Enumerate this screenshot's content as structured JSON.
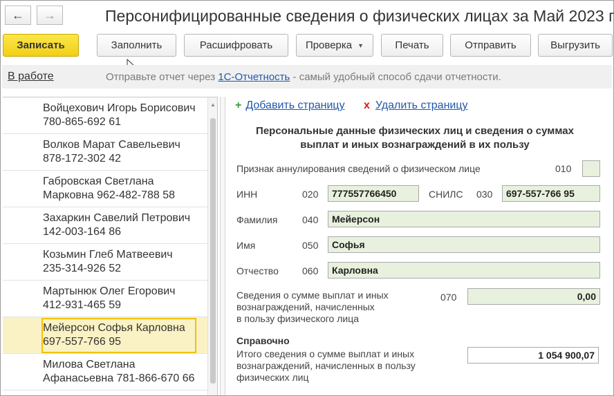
{
  "window": {
    "title": "Персонифицированные сведения о физических лицах за Май 2023 г"
  },
  "toolbar": {
    "write": "Записать",
    "fill": "Заполнить",
    "decode": "Расшифровать",
    "check": "Проверка",
    "print": "Печать",
    "send": "Отправить",
    "export": "Выгрузить"
  },
  "status": {
    "state": "В работе",
    "hint_prefix": "Отправьте отчет через ",
    "hint_link": "1С-Отчетность",
    "hint_suffix": " - самый удобный способ сдачи отчетности."
  },
  "list": {
    "items": [
      {
        "line1": "Войцехович Игорь Борисович",
        "line2": "780-865-692 61"
      },
      {
        "line1": "Волков Марат Савельевич",
        "line2": "878-172-302 42"
      },
      {
        "line1": "Габровская Светлана",
        "line2": "Марковна 962-482-788 58"
      },
      {
        "line1": "Захаркин Савелий Петрович",
        "line2": "142-003-164 86"
      },
      {
        "line1": "Козьмин Глеб Матвеевич",
        "line2": "235-314-926 52"
      },
      {
        "line1": "Мартынюк Олег Егорович",
        "line2": "412-931-465 59"
      },
      {
        "line1": "Мейерсон Софья Карловна",
        "line2": "697-557-766 95"
      },
      {
        "line1": "Милова Светлана",
        "line2": "Афанасьевна 781-866-670 66"
      }
    ],
    "selected_index": 6
  },
  "form": {
    "add_page": "Добавить страницу",
    "delete_page": "Удалить страницу",
    "section_title_1": "Персональные данные физических лиц и сведения о суммах",
    "section_title_2": "выплат и иных вознаграждений в их пользу",
    "annul_label": "Признак аннулирования сведений о физическом лице",
    "annul_code": "010",
    "inn_label": "ИНН",
    "inn_code": "020",
    "inn_value": "777557766450",
    "snils_label": "СНИЛС",
    "snils_code": "030",
    "snils_value": "697-557-766 95",
    "surname_label": "Фамилия",
    "surname_code": "040",
    "surname_value": "Мейерсон",
    "name_label": "Имя",
    "name_code": "050",
    "name_value": "Софья",
    "patronymic_label": "Отчество",
    "patronymic_code": "060",
    "patronymic_value": "Карловна",
    "payments_label_1": "Сведения о сумме выплат и иных",
    "payments_label_2": "вознаграждений, начисленных",
    "payments_label_3": "в пользу физического лица",
    "payments_code": "070",
    "payments_value": "0,00",
    "reference_title": "Справочно",
    "total_label_1": "Итого сведения о сумме выплат и иных",
    "total_label_2": "вознаграждений, начисленных в пользу",
    "total_label_3": "физических лиц",
    "total_value": "1 054 900,07"
  },
  "colors": {
    "primary_button": "#f2cf15",
    "field_bg": "#e8f1de",
    "link": "#2058a8",
    "selection": "#faf2c4"
  }
}
